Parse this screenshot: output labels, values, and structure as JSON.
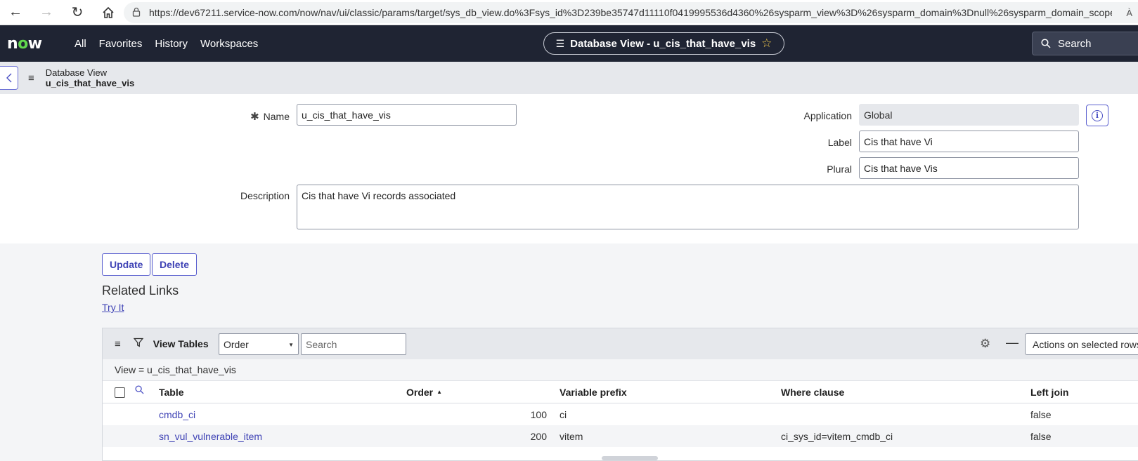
{
  "browser": {
    "url": "https://dev67211.service-now.com/now/nav/ui/classic/params/target/sys_db_view.do%3Fsys_id%3D239be35747d11110f0419995536d4360%26sysparm_view%3D%26sysparm_domain%3Dnull%26sysparm_domain_scope...",
    "reader_label": "À"
  },
  "header": {
    "logo_pre": "n",
    "logo_o": "o",
    "logo_post": "w",
    "nav": [
      "All",
      "Favorites",
      "History",
      "Workspaces"
    ],
    "context_title": "Database View - u_cis_that_have_vis",
    "search_label": "Search"
  },
  "form_header": {
    "line1": "Database View",
    "line2": "u_cis_that_have_vis"
  },
  "form": {
    "name_label": "Name",
    "name_value": "u_cis_that_have_vis",
    "application_label": "Application",
    "application_value": "Global",
    "label_label": "Label",
    "label_value": "Cis that have Vi",
    "plural_label": "Plural",
    "plural_value": "Cis that have Vis",
    "description_label": "Description",
    "description_value": "Cis that have Vi records associated"
  },
  "buttons": {
    "update": "Update",
    "delete": "Delete"
  },
  "related_links": {
    "title": "Related Links",
    "try_it": "Try It"
  },
  "related_list": {
    "title": "View Tables",
    "filter_field": "Order",
    "search_placeholder": "Search",
    "actions_label": "Actions on selected rows",
    "breadcrumb": "View = u_cis_that_have_vis",
    "columns": [
      "Table",
      "Order",
      "Variable prefix",
      "Where clause",
      "Left join"
    ],
    "rows": [
      {
        "table": "cmdb_ci",
        "order": "100",
        "prefix": "ci",
        "where": "",
        "left_join": "false"
      },
      {
        "table": "sn_vul_vulnerable_item",
        "order": "200",
        "prefix": "vitem",
        "where": "ci_sys_id=vitem_cmdb_ci",
        "left_join": "false"
      }
    ]
  },
  "colors": {
    "header_bg": "#1f2433",
    "accent": "#3f43b5",
    "logo_green": "#62d84e",
    "star": "#f2c94c"
  },
  "icons": [
    "back-arrow-icon",
    "forward-arrow-icon",
    "reload-icon",
    "home-icon",
    "lock-icon",
    "list-icon",
    "star-icon",
    "search-icon",
    "chevron-left-icon",
    "hamburger-icon",
    "required-asterisk-icon",
    "info-icon",
    "filter-icon",
    "gear-icon",
    "minus-icon",
    "caret-down-icon",
    "sort-up-icon",
    "checkbox-icon"
  ]
}
